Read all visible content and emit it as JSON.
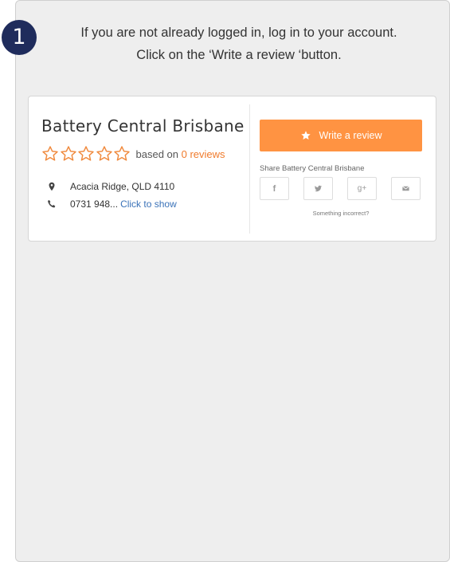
{
  "step": {
    "number": "1"
  },
  "instructions": {
    "line1": "If you are not already logged in, log in to your account.",
    "line2": "Click on the ‘Write a review ‘button."
  },
  "listing": {
    "name": "Battery Central Brisbane",
    "rating": {
      "stars_filled": 0,
      "stars_total": 5,
      "based_on_text": "based on",
      "reviews_text": "0 reviews"
    },
    "address": "Acacia Ridge, QLD 4110",
    "phone_partial": "0731 948...",
    "phone_reveal": "Click to show"
  },
  "actions": {
    "write_review_label": "Write a review",
    "share_label": "Share Battery Central Brisbane",
    "share_buttons": [
      {
        "icon": "facebook-icon",
        "glyph": "f"
      },
      {
        "icon": "twitter-icon",
        "glyph": ""
      },
      {
        "icon": "google-plus-icon",
        "glyph": "g+"
      },
      {
        "icon": "email-icon",
        "glyph": ""
      }
    ],
    "incorrect_text": "Something incorrect?"
  },
  "colors": {
    "accent": "#ff9342",
    "star_outline": "#f08a3e",
    "badge": "#1f2c5c",
    "link": "#3a72b8"
  }
}
